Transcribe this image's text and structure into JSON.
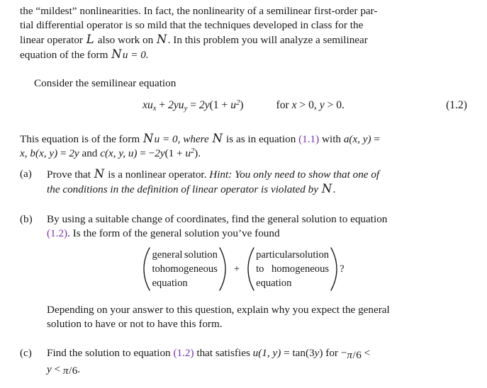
{
  "document": {
    "intro_paragraph": {
      "line1_a": "the “mildest” nonlinearities. In fact, the nonlinearity of a semilinear first-order par-",
      "line2_a": "tial differential operator is so mild that the techniques developed in class for the",
      "line3_a": "linear operator ",
      "script_L": "L",
      "line3_b": " also work on ",
      "script_N1": "N",
      "line3_c": ". In this problem you will analyze a semilinear",
      "line4_a": "equation of the form ",
      "script_N2": "N",
      "line4_b": "u = 0."
    },
    "consider_line": "Consider the semilinear equation",
    "display_equation": {
      "lhs_x": "x",
      "lhs_u1": "u",
      "lhs_sub1": "x",
      "lhs_plus": " + ",
      "lhs_2y": "2y",
      "lhs_u2": "u",
      "lhs_sub2": "y",
      "equals": " = ",
      "rhs_2y": "2y",
      "rhs_open": "(1 + ",
      "rhs_u": "u",
      "rhs_sup": "2",
      "rhs_close": ")",
      "condition_for": "for ",
      "condition_x": "x",
      "condition_gt1": " > 0, ",
      "condition_y": "y",
      "condition_gt2": " > 0.",
      "tag": "(1.2)"
    },
    "form_paragraph": {
      "l1_a": "This equation is of the form ",
      "script_N1": "N",
      "l1_b": "u = 0, where ",
      "script_N2": "N",
      "l1_c": " is as in equation ",
      "link_11": "(1.1)",
      "l1_d": " with ",
      "a_fn": "a",
      "a_args": "(x, y)",
      "l1_e": " =",
      "l2_x": "x",
      "l2_comma": ", ",
      "b_fn": "b",
      "b_args": "(x, y)",
      "l2_eq": " = ",
      "l2_2y": "2y",
      "l2_and": " and ",
      "c_fn": "c",
      "c_args": "(x, y, u)",
      "l2_eq2": " = −",
      "l2_2y2": "2y",
      "l2_open": "(1 + ",
      "l2_u": "u",
      "l2_sup": "2",
      "l2_close": ")."
    },
    "items": [
      {
        "label": "(a)",
        "l1_a": "Prove that ",
        "script_N": "N",
        "l1_b": " is a nonlinear operator. ",
        "hint_head": "Hint: You only need to show that one of",
        "l2_italic": "the conditions in the definition of linear operator is violated by ",
        "l2_script_N": "N",
        "l2_end": "."
      },
      {
        "label": "(b)",
        "l1": "By using a suitable change of coordinates, find the general solution to equation",
        "l2_link": "(1.2)",
        "l2_rest": ". Is the form of the general solution you’ve found"
      },
      {
        "label": "(c)",
        "l1_a": "Find the solution to equation ",
        "link": "(1.2)",
        "l1_b": " that satisfies ",
        "u_fn": "u",
        "u_args": "(1, y)",
        "l1_c": " = tan(3",
        "u_y": "y",
        "l1_d": ") for −",
        "pi1": "π",
        "slash1": "/",
        "six1": "6",
        "l1_e": " <",
        "l2_y": "y",
        "l2_lt": " < ",
        "pi2": "π",
        "slash2": "/",
        "six2": "6",
        "l2_end": "."
      }
    ],
    "vector_expression": {
      "left": {
        "row1_w1": "general",
        "row1_w2": "solution",
        "row2_w1": "to",
        "row2_w2": "homogeneous",
        "row3": "equation"
      },
      "operator": "+",
      "right": {
        "row1_w1": "particular",
        "row1_w2": "solution",
        "row2_w1": "to",
        "row2_w2": "homogeneous",
        "row3": "equation"
      },
      "question_mark": "?"
    },
    "closing_paragraph": {
      "l1": "Depending on your answer to this question, explain why you expect the general",
      "l2": "solution to have or not to have this form."
    }
  },
  "colors": {
    "text": "#181818",
    "link": "#7B30B0",
    "background": "#ffffff"
  }
}
